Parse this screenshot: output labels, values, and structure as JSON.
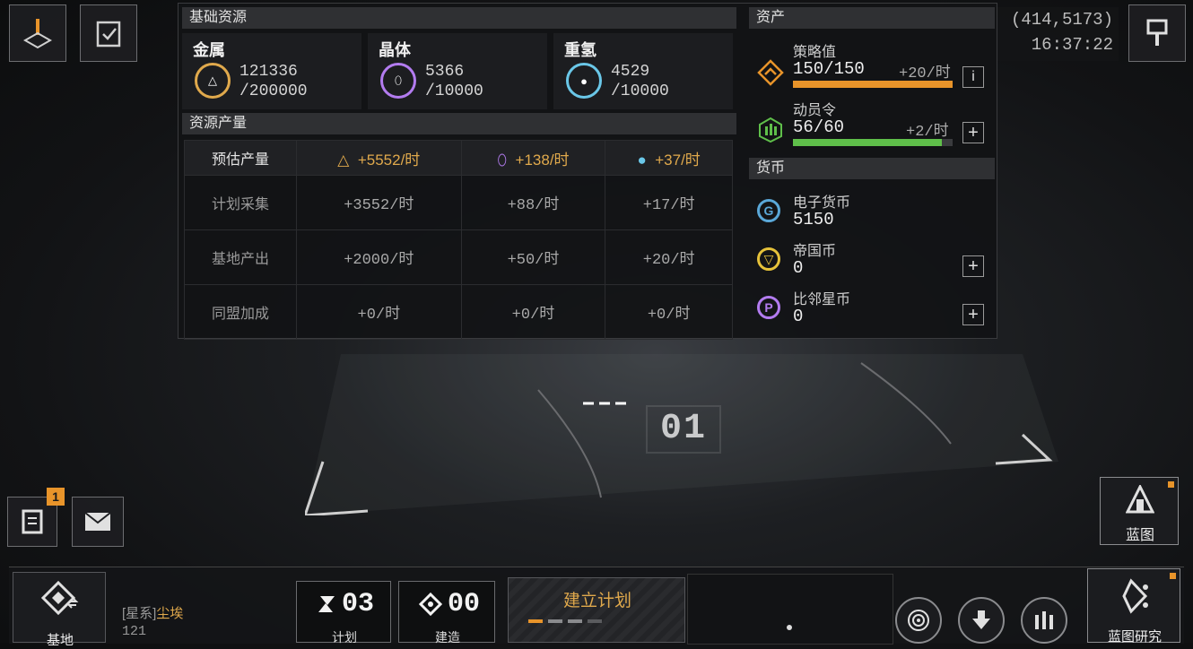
{
  "basic_resources": {
    "header": "基础资源",
    "metal": {
      "label": "金属",
      "value": "121336",
      "cap": "/200000",
      "symbol": "△"
    },
    "crystal": {
      "label": "晶体",
      "value": "5366",
      "cap": "/10000",
      "symbol": "⬯"
    },
    "deuterium": {
      "label": "重氢",
      "value": "4529",
      "cap": "/10000",
      "symbol": "●"
    }
  },
  "production": {
    "header": "资源产量",
    "rows": [
      {
        "label": "预估产量",
        "metal": "+5552/时",
        "crystal": "+138/时",
        "deut": "+37/时"
      },
      {
        "label": "计划采集",
        "metal": "+3552/时",
        "crystal": "+88/时",
        "deut": "+17/时"
      },
      {
        "label": "基地产出",
        "metal": "+2000/时",
        "crystal": "+50/时",
        "deut": "+20/时"
      },
      {
        "label": "同盟加成",
        "metal": "+0/时",
        "crystal": "+0/时",
        "deut": "+0/时"
      }
    ],
    "header_icons": {
      "metal": "△",
      "crystal": "⬯",
      "deut": "●"
    }
  },
  "assets": {
    "header": "资产",
    "strategy": {
      "label": "策略值",
      "value": "150/150",
      "rate": "+20/时",
      "fill": 1.0,
      "button": "i"
    },
    "mobilize": {
      "label": "动员令",
      "value": "56/60",
      "rate": "+2/时",
      "fill": 0.933,
      "button": "+"
    }
  },
  "currency": {
    "header": "货币",
    "items": [
      {
        "label": "电子货币",
        "value": "5150",
        "symbol": "G"
      },
      {
        "label": "帝国币",
        "value": "0",
        "symbol": "▽",
        "button": "+"
      },
      {
        "label": "比邻星币",
        "value": "0",
        "symbol": "P",
        "button": "+"
      }
    ]
  },
  "location": {
    "coords": "(414,5173)",
    "time": "16:37:22"
  },
  "scene": {
    "sector": "01"
  },
  "left_panel": {
    "notification_count": "1"
  },
  "right_side": {
    "blueprint_label": "蓝图",
    "research_label": "蓝图研究"
  },
  "bottom": {
    "base_label": "基地",
    "system_prefix": "[星系]",
    "system_name": "尘埃",
    "system_value": "121",
    "plan_count": "03",
    "plan_label": "计划",
    "build_count": "00",
    "build_label": "建造",
    "establish_plan": "建立计划"
  },
  "colors": {
    "accent_orange": "#e0a94c",
    "bar_orange": "#e8942a",
    "bar_green": "#5fbf4a",
    "icon_purple": "#b37cf0",
    "icon_cyan": "#6ac7e8"
  }
}
